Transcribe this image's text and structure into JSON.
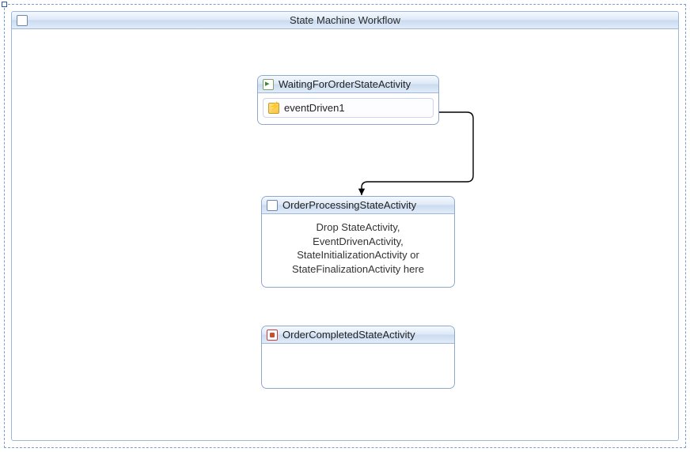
{
  "workflow": {
    "title": "State Machine Workflow"
  },
  "states": {
    "waiting": {
      "title": "WaitingForOrderStateActivity",
      "event1": "eventDriven1"
    },
    "processing": {
      "title": "OrderProcessingStateActivity",
      "drop_hint_line1": "Drop StateActivity,",
      "drop_hint_line2": "EventDrivenActivity,",
      "drop_hint_line3": "StateInitializationActivity or",
      "drop_hint_line4": "StateFinalizationActivity here"
    },
    "completed": {
      "title": "OrderCompletedStateActivity"
    }
  }
}
